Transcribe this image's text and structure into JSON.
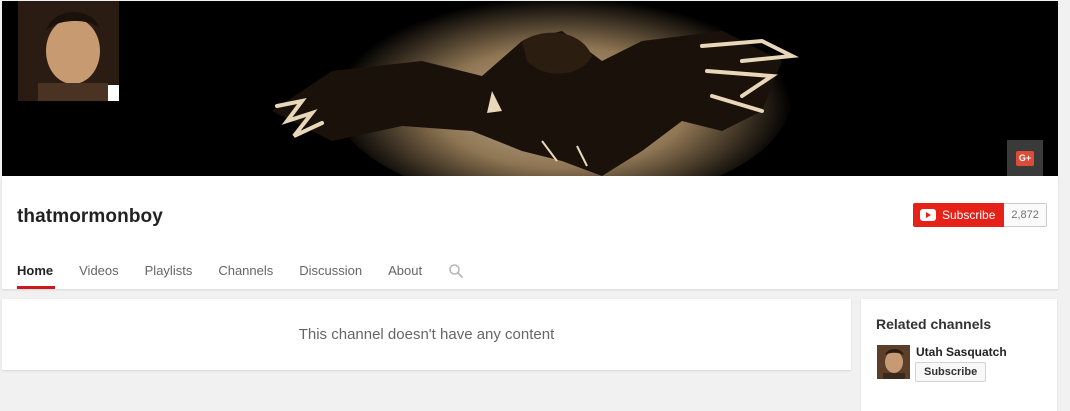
{
  "channel": {
    "name": "thatmormonboy",
    "subscribe_label": "Subscribe",
    "subscriber_count": "2,872",
    "gplus_label": "G+"
  },
  "tabs": [
    {
      "label": "Home",
      "active": true
    },
    {
      "label": "Videos",
      "active": false
    },
    {
      "label": "Playlists",
      "active": false
    },
    {
      "label": "Channels",
      "active": false
    },
    {
      "label": "Discussion",
      "active": false
    },
    {
      "label": "About",
      "active": false
    }
  ],
  "content": {
    "empty_message": "This channel doesn't have any content"
  },
  "related": {
    "title": "Related channels",
    "channels": [
      {
        "name": "Utah Sasquatch",
        "subscribe_label": "Subscribe"
      }
    ]
  },
  "colors": {
    "accent": "#e62117",
    "tab_underline": "#cc181e",
    "banner_bg": "#000000",
    "banner_art": "#c9b08a"
  },
  "icons": {
    "search": "search-icon",
    "youtube": "youtube-logo-icon",
    "gplus": "google-plus-icon"
  }
}
